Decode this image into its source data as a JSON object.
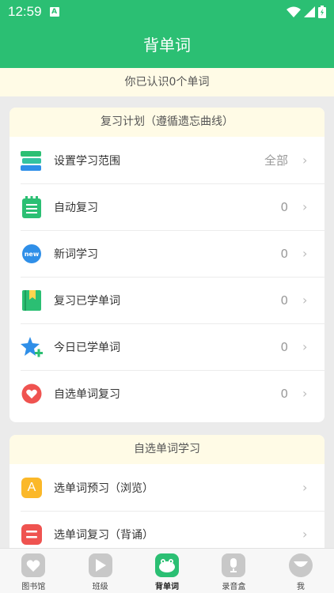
{
  "status": {
    "time": "12:59",
    "a_badge": "A"
  },
  "header": {
    "title": "背单词"
  },
  "banner": {
    "text": "你已认识0个单词"
  },
  "plan": {
    "title": "复习计划（遵循遗忘曲线）",
    "items": [
      {
        "label": "设置学习范围",
        "value": "全部",
        "icon": "books-icon",
        "color": "#2bbf73"
      },
      {
        "label": "自动复习",
        "value": "0",
        "icon": "notepad-icon",
        "color": "#2bbf73"
      },
      {
        "label": "新词学习",
        "value": "0",
        "icon": "new-badge-icon",
        "color": "#2f8fe8"
      },
      {
        "label": "复习已学单词",
        "value": "0",
        "icon": "bookmark-book-icon",
        "color": "#2bbf73"
      },
      {
        "label": "今日已学单词",
        "value": "0",
        "icon": "star-plus-icon",
        "color": "#2f8fe8"
      },
      {
        "label": "自选单词复习",
        "value": "0",
        "icon": "heart-icon",
        "color": "#ef5350"
      }
    ]
  },
  "custom": {
    "title": "自选单词学习",
    "items": [
      {
        "label": "选单词预习（浏览）",
        "icon": "letter-a-icon",
        "icon_text": "A",
        "color": "#fbb829"
      },
      {
        "label": "选单词复习（背诵）",
        "icon": "card-list-icon",
        "color": "#ef5350"
      }
    ]
  },
  "tabs": [
    {
      "label": "图书馆",
      "icon": "heart-tab-icon"
    },
    {
      "label": "班级",
      "icon": "play-tab-icon"
    },
    {
      "label": "背单词",
      "icon": "frog-tab-icon",
      "active": true
    },
    {
      "label": "录音盒",
      "icon": "mic-tab-icon"
    },
    {
      "label": "我",
      "icon": "face-tab-icon"
    }
  ]
}
